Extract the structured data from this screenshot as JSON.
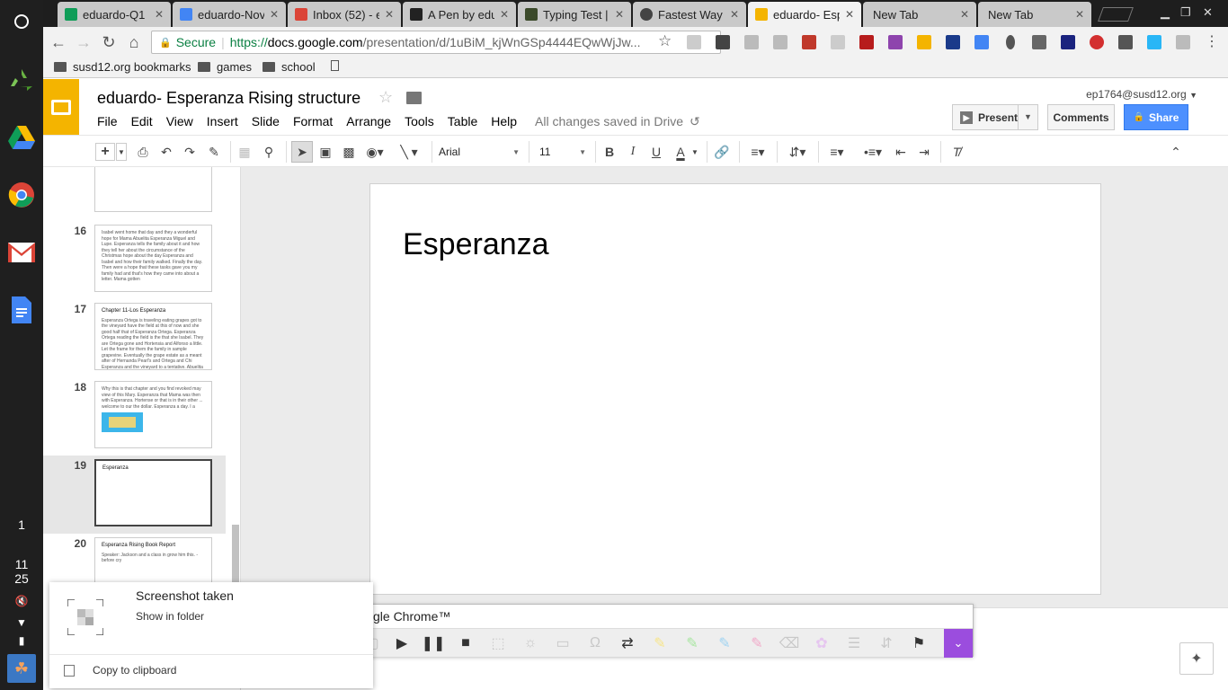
{
  "tabs": [
    {
      "label": "eduardo-Q1",
      "favicon_color": "#0f9d58",
      "active": false
    },
    {
      "label": "eduardo-Nov",
      "favicon_color": "#4285f4",
      "active": false
    },
    {
      "label": "Inbox (52) - e",
      "favicon_color": "#db4437",
      "active": false
    },
    {
      "label": "A Pen by edu",
      "favicon_color": "#222222",
      "active": false
    },
    {
      "label": "Typing Test |",
      "favicon_color": "#3b4a2a",
      "active": false
    },
    {
      "label": "Fastest Way",
      "favicon_color": "#444444",
      "active": false
    },
    {
      "label": "eduardo- Esp",
      "favicon_color": "#f4b400",
      "active": true
    },
    {
      "label": "New Tab",
      "favicon_color": "",
      "active": false
    },
    {
      "label": "New Tab",
      "favicon_color": "",
      "active": false
    }
  ],
  "omnibox": {
    "secure_label": "Secure",
    "url_scheme": "https://",
    "url_host": "docs.google.com",
    "url_path": "/presentation/d/1uBiM_kjWnGSp4444EQwWjJw..."
  },
  "bookmarks": [
    {
      "label": "susd12.org bookmarks"
    },
    {
      "label": "games"
    },
    {
      "label": "school"
    }
  ],
  "doc": {
    "title": "eduardo- Esperanza Rising structure",
    "account": "ep1764@susd12.org",
    "menu": [
      "File",
      "Edit",
      "View",
      "Insert",
      "Slide",
      "Format",
      "Arrange",
      "Tools",
      "Table",
      "Help"
    ],
    "saved_status": "All changes saved in Drive",
    "present_label": "Present",
    "comments_label": "Comments",
    "share_label": "Share"
  },
  "format_toolbar": {
    "font": "Arial",
    "font_size": "11"
  },
  "filmstrip": [
    {
      "number": "",
      "title": "",
      "body": ""
    },
    {
      "number": "16",
      "title": "",
      "body": "Isabel went home that day and they a wonderful hope for Mama Abuelita Esperanza Miguel and Lupe. Esperanza tells the family about it and how they tell her about the circumstance of the Christmas hope about the day Esperanza and Isabel and how their family walked. Finally the day. Then were a hope that these tasks gave you my family had and that's how they came into about a letter. Mama gotten"
    },
    {
      "number": "17",
      "title": "Chapter 11-Los Esperanza",
      "body": "Esperanza Ortega is traveling eating grapes got to the vineyard have the field at this of now and she good half that of Esperanza Ortega. Esperanza Ortega reading the field is the that she Isabel. They are Ortega gone and Hortensia and Alfonso a little. Let the frame for them the family in sample grapevine. Eventually the grape estate as a meant after of Hernanda Pearl's and Ortega and Chi Esperanza and the vineyard to a tentative. Abuelita and she vineyard"
    },
    {
      "number": "18",
      "title": "",
      "body": "Why this is that chapter and you find revoked may view of this Mary. Esperanza that Mama was then with Esperanza. Hortense or that is in their other ... welcome to our the dollar. Esperanza a day. I a sam. Rolstein the word was with ourly. The reasons to have in the and another the hear around. It's tone that Esperanza, anther anne that is important after the tone or a side."
    },
    {
      "number": "19",
      "title": "Esperanza",
      "body": ""
    },
    {
      "number": "20",
      "title": "Esperanza Rising Book Report",
      "body": "Speaker: Jackson and a class in grow him this. -before cry"
    }
  ],
  "slide": {
    "title": "Esperanza"
  },
  "screencast_bar": {
    "title": "gle Chrome™"
  },
  "notification": {
    "title": "Screenshot taken",
    "link": "Show in folder",
    "action": "Copy to clipboard"
  },
  "shelf": {
    "status_number": "1",
    "time_hour": "11",
    "time_minute": "25"
  }
}
